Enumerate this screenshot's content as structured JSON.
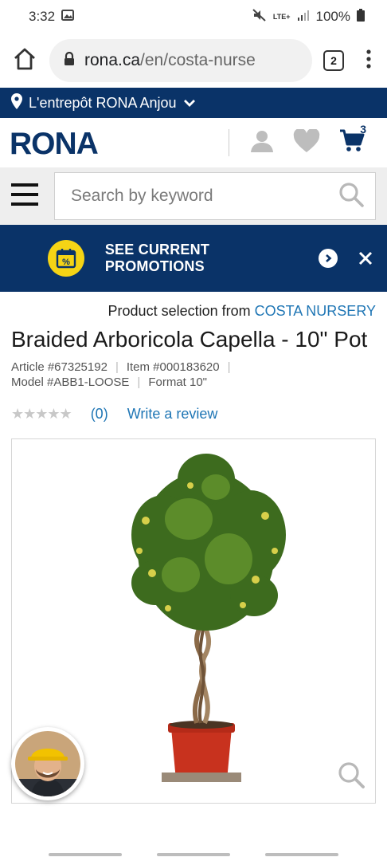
{
  "status": {
    "time": "3:32",
    "battery": "100%",
    "network": "LTE+"
  },
  "browser": {
    "url_domain": "rona.ca",
    "url_path": "/en/costa-nurse",
    "tab_count": "2"
  },
  "store": {
    "name": "L'entrepôt RONA Anjou"
  },
  "header": {
    "logo": "RONA",
    "cart_count": "3"
  },
  "search": {
    "placeholder": "Search by keyword"
  },
  "promo": {
    "label": "SEE CURRENT PROMOTIONS"
  },
  "product": {
    "seller_prefix": "Product selection from",
    "seller_name": "COSTA NURSERY",
    "title": "Braided Arboricola Capella - 10\" Pot",
    "article": "Article #67325192",
    "item": "Item #000183620",
    "model": "Model #ABB1-LOOSE",
    "format": "Format 10\"",
    "stars": "★★★★★",
    "review_count": "(0)",
    "write_review": "Write a review",
    "rating_value": 0
  },
  "colors": {
    "brand_blue": "#0a3368",
    "link_blue": "#1f76b5",
    "promo_yellow": "#f5d415"
  }
}
